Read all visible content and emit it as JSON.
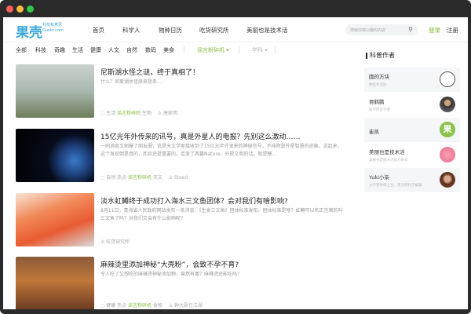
{
  "header": {
    "logo": "果壳",
    "logo_tagline": "科技有意思",
    "logo_domain": "Guokr.com",
    "nav": [
      "首页",
      "科学人",
      "物种日历",
      "吃货研究所",
      "美丽也是技术活"
    ],
    "search_placeholder": "搜索你感兴趣的内容",
    "search_icon": "search-icon",
    "login": "登录",
    "register": "注册"
  },
  "categories": [
    "全部",
    "科技",
    "奇趣",
    "生活",
    "健康",
    "人文",
    "自然",
    "数码",
    "美食"
  ],
  "dropdowns": [
    "谣言粉碎机 ▾",
    "学科 ▾"
  ],
  "articles": [
    {
      "title": "尼斯湖水怪之谜，终于真相了！",
      "desc": "什么？尼斯湖水怪原来是条...",
      "tags": [
        "生活·",
        "谣言粉碎机",
        "·生物"
      ],
      "author": "唐家明"
    },
    {
      "title": "15亿光年外传来的讯号，真是外星人的电报？先别这么激动……",
      "desc": "一则消息又刷爆了朋友圈，说是天文学家接收到了15亿光年外发来的神秘信号，不排除是外星智慧的迹象。说起来，这个发现倒是真的，而且还挺重要的，连发了两篇Nature。外星文明的话，就是瞎…",
      "tags": [
        "自然·热点·",
        "谣言粉碎机",
        "·天文"
      ],
      "author": "Steed"
    },
    {
      "title": "淡水虹鳟终于成功打入海水三文鱼团体？会对我们有啥影响?",
      "desc": "8月11日，青海省人民政府网站发布一条消息：《生食三文鱼》团体标准发布。团体标准是啥？虹鳟可以名正言顺的叫三文鱼了吗？对我们又会有什么影响呢?",
      "tags": [
        "",
        "",
        ""
      ],
      "author": "吃货研究所"
    },
    {
      "title": "麻辣烫里添加神秘“大壳粉”，会致不孕不育?",
      "desc": "令人吃了又想吃的麻辣烫神秘添加物，竟然有毒？麻辣烫还能吃吗?",
      "tags": [
        "健康·热点·",
        "谣言粉碎机",
        "·食物"
      ],
      "author": "钟大厨在江湖"
    }
  ],
  "sidebar": {
    "title": "科普作者",
    "authors": [
      {
        "name": "圆的方块",
        "sub": "拥挂青话题"
      },
      {
        "name": "贾鹤鹏",
        "sub": "科学传论学者"
      },
      {
        "name": "崔凯",
        "sub": ""
      },
      {
        "name": "美丽也是技术活",
        "sub": "美丽也是技术活官方帐号"
      },
      {
        "name": "Yuki小柒",
        "sub": "分子营养博士生，果壳网科学编辑"
      }
    ]
  },
  "colors": {
    "brand_green": "#7ab929",
    "brand_blue": "#3aa7d9"
  }
}
